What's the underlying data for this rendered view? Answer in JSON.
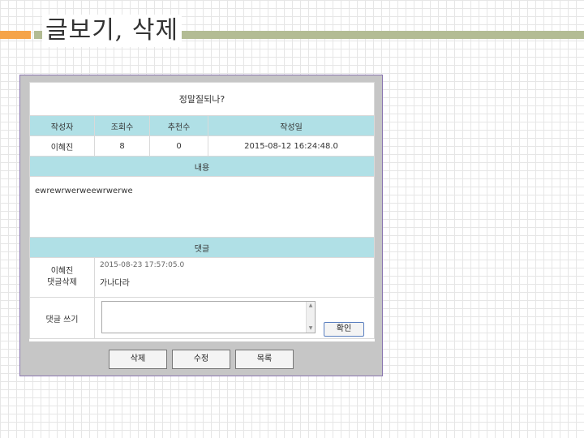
{
  "slide": {
    "title": "글보기, 삭제"
  },
  "post": {
    "title": "정말질되나?",
    "headers": {
      "author": "작성자",
      "views": "조회수",
      "recommends": "추천수",
      "date": "작성일"
    },
    "author": "이혜진",
    "views": "8",
    "recommends": "0",
    "date": "2015-08-12 16:24:48.0",
    "content_header": "내용",
    "content": "ewrewrwerweewrwerwe"
  },
  "comments": {
    "header": "댓글",
    "items": [
      {
        "author": "이혜진",
        "delete_label": "댓글삭제",
        "date": "2015-08-23 17:57:05.0",
        "text": "가나다라"
      }
    ],
    "write_label": "댓글 쓰기",
    "confirm_label": "확인"
  },
  "actions": {
    "delete": "삭제",
    "edit": "수정",
    "list": "목록"
  },
  "colors": {
    "header_bg": "#b0e0e6",
    "accent": "#f5a44a",
    "title_bar": "#b3bc94",
    "frame_border": "#8a76b0"
  }
}
